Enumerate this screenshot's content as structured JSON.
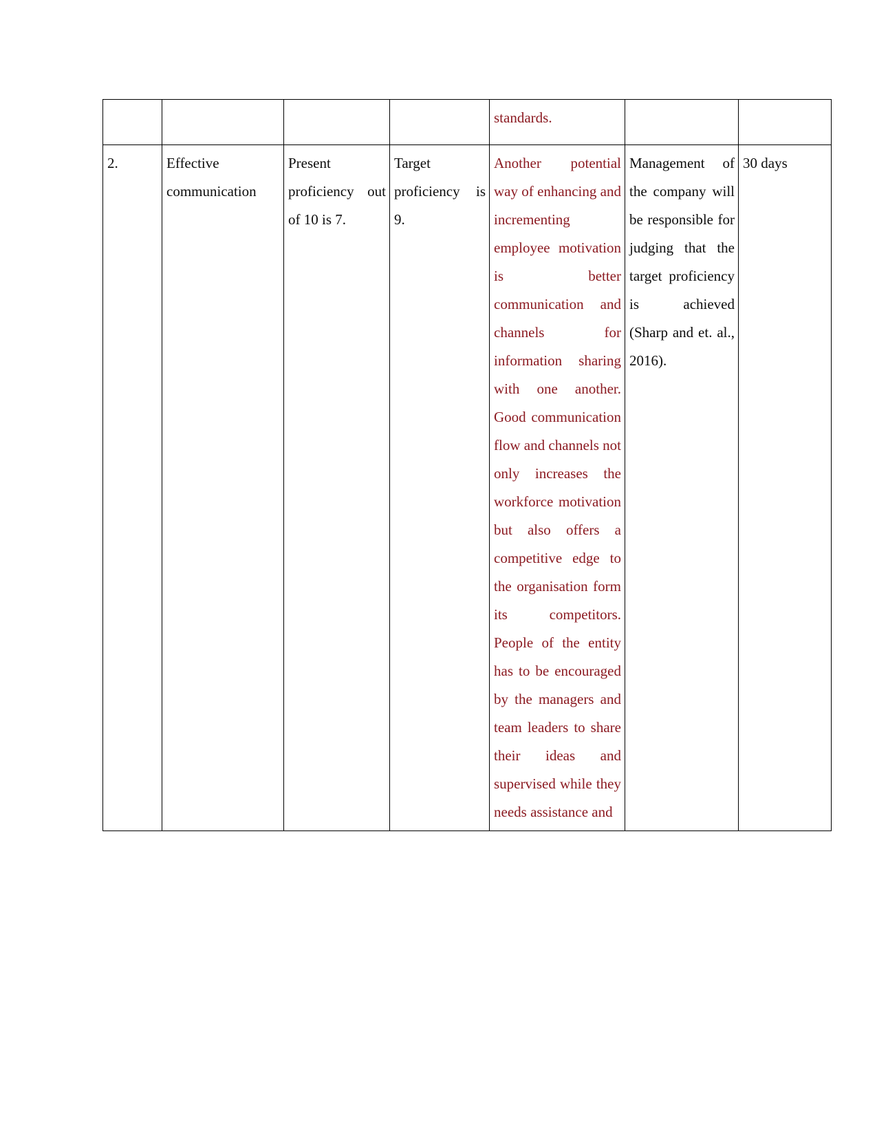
{
  "document": {
    "type": "table-continuation",
    "page_background": "#ffffff",
    "text_colors": {
      "black": "#0d0d0d",
      "red": "#8c1b22"
    }
  },
  "table": {
    "columns": 7,
    "rows": [
      {
        "name": "continuation-row",
        "cells": [
          {
            "text": "",
            "color": "black"
          },
          {
            "text": "",
            "color": "black"
          },
          {
            "text": "",
            "color": "black"
          },
          {
            "text": "",
            "color": "black"
          },
          {
            "text": "standards.",
            "color": "red"
          },
          {
            "text": "",
            "color": "black"
          },
          {
            "text": "",
            "color": "black"
          }
        ]
      },
      {
        "name": "item-2-row",
        "cells": [
          {
            "text": "2.",
            "color": "black"
          },
          {
            "text": "Effective communication",
            "color": "black"
          },
          {
            "text": "Present proficiency out of 10 is 7.",
            "color": "black"
          },
          {
            "text": "Target proficiency is 9.",
            "color": "black"
          },
          {
            "text": "Another potential way of enhancing and incrementing employee motivation is better communication and channels for information sharing with one another. Good communication flow and channels not only increases the workforce motivation but also offers a competitive edge to the organisation form its competitors. People of the entity has to be encouraged by the managers and team leaders to share their ideas and supervised while they needs assistance and",
            "color": "red"
          },
          {
            "text": "Management of the company will be responsible for judging that the target proficiency is achieved (Sharp and et. al., 2016).",
            "color": "black"
          },
          {
            "text": "30 days",
            "color": "black"
          }
        ]
      }
    ]
  }
}
